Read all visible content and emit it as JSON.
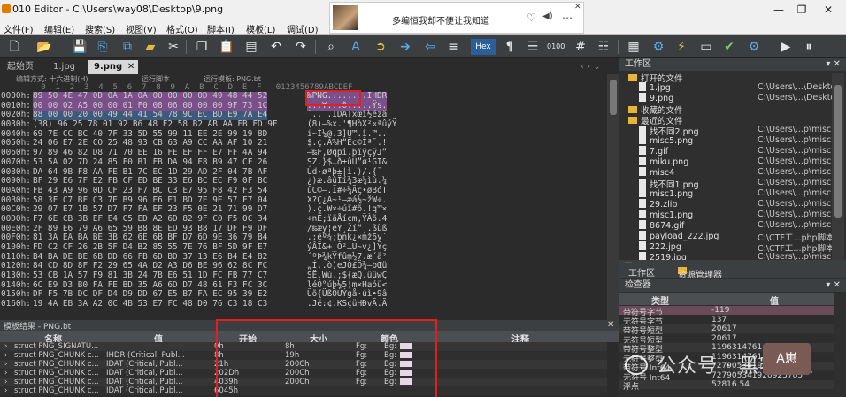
{
  "titlebar": {
    "title": "010 Editor - C:\\Users\\way08\\Desktop\\9.png",
    "icon": "app-logo",
    "minimize": "—",
    "restore": "❐",
    "close": "✕"
  },
  "music_popup": {
    "song": "多编恒我却不便让我知道",
    "heart": "♡",
    "volume": "◀)",
    "more": "⋯",
    "close": "✕"
  },
  "menu": [
    "文件(F)",
    "编辑(E)",
    "搜索(S)",
    "视图(V)",
    "格式(O)",
    "脚本(I)",
    "模板(L)",
    "调试(D)"
  ],
  "toolbar": {
    "hex_label": "Hex",
    "icons": [
      "new-file-icon",
      "open-folder-icon",
      "save-icon",
      "save-all-icon",
      "copy-icon",
      "folder-icon",
      "cut-icon",
      "paste-icon",
      "undo-icon",
      "redo-icon",
      "find-icon",
      "replace-icon",
      "goto-icon",
      "arrow-right-icon",
      "arrow-left-icon",
      "pilcrow-icon",
      "binary-icon",
      "hash-icon",
      "template-icon",
      "compare-icon",
      "calc-icon",
      "tools-icon",
      "run-icon",
      "stop-icon"
    ]
  },
  "tabs": {
    "items": [
      "起始页",
      "1.jpg",
      "9.png"
    ],
    "active_index": 2,
    "close": "✕"
  },
  "editor": {
    "edit_mode": "编辑方式: 十六进制(H)",
    "run_script": "运行脚本",
    "run_template": "运行模板: PNG.bt",
    "column_header": "   0  1  2  3  4  5  6  7  8  9  A  B  C  D  E  F   0123456789ABCDEF",
    "rows": [
      {
        "addr": "0000h:",
        "hex": "89 50 4E 47 0D 0A 1A 0A 00 00 00 0D 49 48 44 52",
        "text": "‰PNG........IHDR"
      },
      {
        "addr": "0010h:",
        "hex": "00 00 02 A5 00 00 01 F0 08 06 00 00 00 9F 73 1C",
        "text": "...¥...ð.....Ÿs."
      },
      {
        "addr": "0020h:",
        "hex": "88 00 00 20 00 49 44 41 54 78 9C EC BD E9 7A E4",
        "text": "ˆ.. .IDATxœì½éză"
      },
      {
        "addr": "0030h:",
        "hex": "(38) 96 25 78 01 92 B6 48 F2 58 B2 AB AA FB FD 9F",
        "text": "(8)–%x.'¶HòX²«ªûýŸ"
      },
      {
        "addr": "0040h:",
        "hex": "69 7E CC BC 40 7F 33 5D 55 99 11 EE 2E 99 19 8D",
        "text": "i~Ì¼@.3]U™.î.™.."
      },
      {
        "addr": "0050h:",
        "hex": "24 06 E7 2E CO 25 48 93 CB 63 A9 CC AA AF 10 21",
        "text": "$.ç.À%H“Ëc©Ìª¯.!"
      },
      {
        "addr": "0060h:",
        "hex": "97 89 46 82 D8 71 70 EE 16 FE EF FF E7 FF 4A 94",
        "text": "—‰F‚Øqpî.þïÿçÿJ”"
      },
      {
        "addr": "0070h:",
        "hex": "53 5A 02 7D 24 85 F0 B1 FB DA 94 F8 B9 47 CF 26",
        "text": "SZ.}$…ð±ûÚ”ø¹GÏ&"
      },
      {
        "addr": "0080h:",
        "hex": "DA 64 9B F8 AA FE B1 7C EC 1D 29 AD 2F 04 7B AF",
        "text": "Úd›øªþ±|ì.)­/.{¯"
      },
      {
        "addr": "0090h:",
        "hex": "BF 29 E6 7F E2 FB CF ED BE 33 E6 BC EC F9 0F BC",
        "text": "¿)æ.âûÏí¾3æ¼ìù.¼"
      },
      {
        "addr": "00A0h:",
        "hex": "FB 43 A9 96 0D CF 23 F7 BC C3 E7 95 F8 42 F3 54",
        "text": "ûC©–.Ï#÷¼Ãç•øBóT"
      },
      {
        "addr": "00B0h:",
        "hex": "58 3F C7 BF C3 7E B9 96 E6 E1 BD 7E 9E 57 F7 04",
        "text": "X?Ç¿Ã~¹–æá½~žW÷."
      },
      {
        "addr": "00C0h:",
        "hex": "29 07 E7 1B 57 D7 F7 FA EF 23 F5 0E 21 71 99 D7",
        "text": ").ç.W×÷úï#õ.!q™×"
      },
      {
        "addr": "00D0h:",
        "hex": "F7 6E CB 3B EF E4 C5 ED A2 6D 82 9F C0 F5 0C 34",
        "text": "÷nË;ïäÅí¢m‚ŸÀõ.4"
      },
      {
        "addr": "00E0h:",
        "hex": "2F 89 E6 79 A6 65 59 B8 8E ED 93 B8 17 DF F9 DF",
        "text": "/‰æy¦eY¸Ží“¸.ßùß"
      },
      {
        "addr": "00F0h:",
        "hex": "81 3A EA BA BE 3B 62 6E 6B BF D7 6D 9E 36 79 B4",
        "text": ".:êº¾;bnk¿×mž6y´"
      },
      {
        "addr": "0100h:",
        "hex": "FD C2 CF 26 2B 5F D4 B2 85 55 7E 76 BF 5D 9F E7",
        "text": "ýÂÏ&+_Ô²…U~v¿]Ÿç"
      },
      {
        "addr": "0110h:",
        "hex": "B4 BA DE BE 6B DD 66 FB 6D BD 37 13 E6 B4 E4 B2",
        "text": "´ºÞ¾kÝfûm½7.æ´ä²"
      },
      {
        "addr": "0120h:",
        "hex": "84 CD 8D 8F F2 29 65 4A D2 A3 D6 BE 96 62 8C FC",
        "text": "„Í..ò)eJÒ£Ö¾–bŒü"
      },
      {
        "addr": "0130h:",
        "hex": "53 CB 1A 57 F9 81 3B 24 7B E6 51 1D FC FB 77 C7",
        "text": "SË.Wù.;${æQ.üûwÇ"
      },
      {
        "addr": "0140h:",
        "hex": "6C E9 D3 B0 FA FE BD 35 A6 6D D7 48 61 F3 FC 3C",
        "text": "léÓ°úþ½5¦m×Haóü<"
      },
      {
        "addr": "0150h:",
        "hex": "DF F5 7B DC DF D4 D9 DD 67 E5 B7 FA EC 95 39 E2",
        "text": "Üõ{ÜßÔÙÝgå·úì•9â"
      },
      {
        "addr": "0160h:",
        "hex": "19 4A EB 3A A2 0C 4B 53 E7 FC 48 D0 76 C3 18 C3",
        "text": ".Jë:¢.KSçüHÐvÃ.Ã"
      }
    ]
  },
  "template_results": {
    "title": "模板结果 - PNG.bt",
    "columns": [
      "名称",
      "值",
      "开始",
      "大小",
      "颜色",
      "注释"
    ],
    "rows": [
      {
        "name": "struct PNG_SIGNATU...",
        "value": "",
        "start": "0h",
        "size": "8h",
        "fg": "Fg:",
        "bg": "Bg:"
      },
      {
        "name": "struct PNG_CHUNK c...",
        "value": "IHDR  (Critical, Publ...",
        "start": "8h",
        "size": "19h",
        "fg": "Fg:",
        "bg": "Bg:"
      },
      {
        "name": "struct PNG_CHUNK c...",
        "value": "IDAT  (Critical, Publ...",
        "start": "21h",
        "size": "200Ch",
        "fg": "Fg:",
        "bg": "Bg:"
      },
      {
        "name": "struct PNG_CHUNK c...",
        "value": "IDAT  (Critical, Publ...",
        "start": "202Dh",
        "size": "200Ch",
        "fg": "Fg:",
        "bg": "Bg:"
      },
      {
        "name": "struct PNG_CHUNK c...",
        "value": "IDAT  (Critical, Publ...",
        "start": "4039h",
        "size": "200Ch",
        "fg": "Fg:",
        "bg": "Bg:"
      },
      {
        "name": "struct PNG_CHUNK c...",
        "value": "IDAT  (Critical, Publ...",
        "start": "6045h",
        "size": "",
        "fg": "",
        "bg": ""
      }
    ]
  },
  "workarea": {
    "title": "工作区",
    "items": [
      {
        "label": "打开的文件",
        "path": "",
        "kind": "folder",
        "indent": 0
      },
      {
        "label": "1.jpg",
        "path": "C:\\Users\\...\\Desktop\\",
        "kind": "file",
        "indent": 1
      },
      {
        "label": "9.png",
        "path": "C:\\Users\\...\\Desktop\\",
        "kind": "file",
        "indent": 1
      },
      {
        "label": "收藏的文件",
        "path": "",
        "kind": "folder",
        "indent": 0
      },
      {
        "label": "最近的文件",
        "path": "",
        "kind": "folder",
        "indent": 0
      },
      {
        "label": "找不同2.png",
        "path": "C:\\Users\\...p\\misc3\\",
        "kind": "file",
        "indent": 1
      },
      {
        "label": "misc5.png",
        "path": "C:\\Users\\...p\\misc3\\",
        "kind": "file",
        "indent": 1
      },
      {
        "label": "7.gif",
        "path": "C:\\Users\\...p\\misc3\\",
        "kind": "file",
        "indent": 1
      },
      {
        "label": "miku.png",
        "path": "C:\\Users\\...p\\misc3\\",
        "kind": "file",
        "indent": 1
      },
      {
        "label": "misc4",
        "path": "C:\\Users\\...p\\misc3\\",
        "kind": "file",
        "indent": 1
      },
      {
        "label": "找不同1.png",
        "path": "C:\\Users\\...p\\misc3\\",
        "kind": "file",
        "indent": 1
      },
      {
        "label": "misc1.png",
        "path": "C:\\Users\\...p\\misc3\\",
        "kind": "file",
        "indent": 1
      },
      {
        "label": "29.zlib",
        "path": "C:\\Users\\...p\\misc3\\",
        "kind": "file",
        "indent": 1
      },
      {
        "label": "misc1.png",
        "path": "C:\\Users\\...p\\misc3\\",
        "kind": "file",
        "indent": 1
      },
      {
        "label": "8674.gif",
        "path": "C:\\Users\\...p\\misc3\\",
        "kind": "file",
        "indent": 1
      },
      {
        "label": "payload_222.jpg",
        "path": "C:\\CTF工...php脚本\\",
        "kind": "file",
        "indent": 1
      },
      {
        "label": "222.jpg",
        "path": "C:\\CTF工...php脚本\\",
        "kind": "file",
        "indent": 1
      },
      {
        "label": "2519.jpg",
        "path": "C:\\Users\\...p\\misc3\\",
        "kind": "file",
        "indent": 1
      }
    ],
    "tabs": [
      "工作区",
      "资源管理器"
    ]
  },
  "inspector": {
    "title": "检查器",
    "columns": [
      "类型",
      "值"
    ],
    "rows": [
      {
        "type": "带符号字节",
        "value": "-119",
        "sel": true
      },
      {
        "type": "无符号字节",
        "value": "137",
        "sel": false
      },
      {
        "type": "带符号短型",
        "value": "20617",
        "sel": false
      },
      {
        "type": "无符号短型",
        "value": "20617",
        "sel": false
      },
      {
        "type": "带符号整型",
        "value": "1196314761",
        "sel": false
      },
      {
        "type": "无符号整型",
        "value": "1196314761",
        "sel": false
      },
      {
        "type": "带符号 Int64",
        "value": "727905341920923785",
        "sel": false
      },
      {
        "type": "无符号 Int64",
        "value": "727905341920923785",
        "sel": false
      },
      {
        "type": "浮点",
        "value": "52816.54",
        "sel": false
      }
    ]
  },
  "watermark": {
    "text": "公众号 · 黑客A崽",
    "stamp": "A崽"
  },
  "colors": {
    "accent_blue": "#2a5f9a",
    "highlight_purple": "#7a4f8a",
    "red_box": "#e02020"
  }
}
